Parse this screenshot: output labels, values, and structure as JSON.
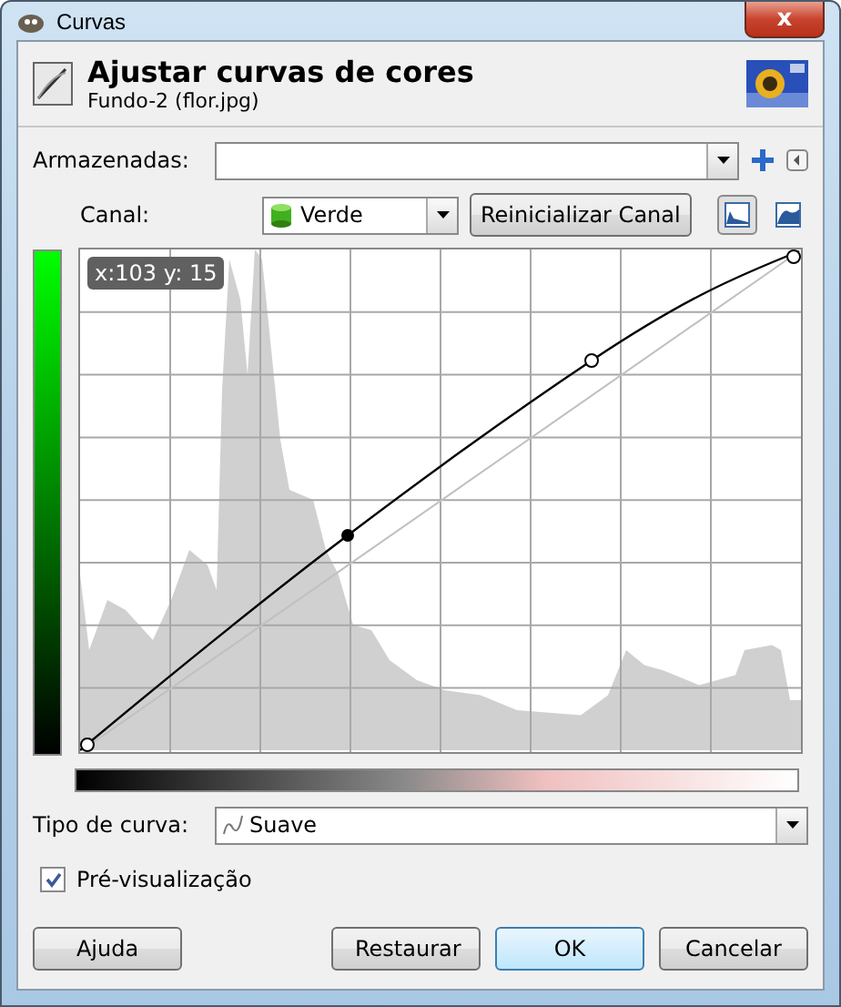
{
  "window": {
    "title": "Curvas",
    "close": "x"
  },
  "header": {
    "title": "Ajustar curvas de cores",
    "subtitle": "Fundo-2 (flor.jpg)"
  },
  "presets": {
    "label": "Armazenadas:"
  },
  "channel": {
    "label": "Canal:",
    "value": "Verde",
    "reset": "Reinicializar Canal"
  },
  "scale_buttons": [
    {
      "kind": "linear",
      "selected": true
    },
    {
      "kind": "log",
      "selected": false
    }
  ],
  "graph": {
    "readout": "x:103 y: 15"
  },
  "curve_type": {
    "label": "Tipo de curva:",
    "value": "Suave"
  },
  "preview": {
    "label": "Pré-visualização",
    "checked": true
  },
  "buttons": [
    {
      "label": "Ajuda",
      "default": false
    },
    {
      "label": "Restaurar",
      "default": false
    },
    {
      "label": "OK",
      "default": true
    },
    {
      "label": "Cancelar",
      "default": false
    }
  ]
}
